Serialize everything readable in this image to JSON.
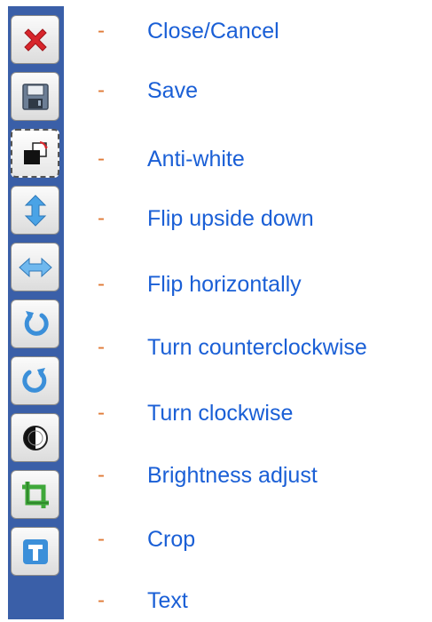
{
  "tools": [
    {
      "id": "close",
      "icon": "close-icon",
      "dash": "-",
      "label": "Close/Cancel"
    },
    {
      "id": "save",
      "icon": "floppy-disk-icon",
      "dash": "-",
      "label": "Save"
    },
    {
      "id": "anti-white",
      "icon": "invert-colors-icon",
      "dash": "-",
      "label": "Anti-white"
    },
    {
      "id": "flip-vertical",
      "icon": "vertical-arrows-icon",
      "dash": "-",
      "label": "Flip upside down"
    },
    {
      "id": "flip-horizontal",
      "icon": "horizontal-arrows-icon",
      "dash": "-",
      "label": "Flip horizontally"
    },
    {
      "id": "rotate-ccw",
      "icon": "rotate-left-icon",
      "dash": "-",
      "label": "Turn counterclockwise"
    },
    {
      "id": "rotate-cw",
      "icon": "rotate-right-icon",
      "dash": "-",
      "label": "Turn clockwise"
    },
    {
      "id": "brightness",
      "icon": "contrast-icon",
      "dash": "-",
      "label": "Brightness adjust"
    },
    {
      "id": "crop",
      "icon": "crop-icon",
      "dash": "-",
      "label": "Crop"
    },
    {
      "id": "text",
      "icon": "text-t-icon",
      "dash": "-",
      "label": "Text"
    }
  ],
  "colors": {
    "toolbar_bg": "#3a5fa8",
    "label_text": "#1a5fd6",
    "dash": "#e07a36",
    "close_red": "#d8262c",
    "arrow_blue": "#4aa3e6",
    "crop_green": "#3fa83a",
    "text_blue": "#3b8fd9"
  }
}
